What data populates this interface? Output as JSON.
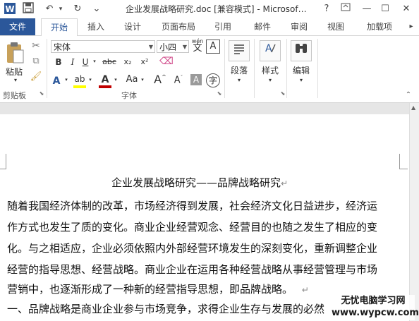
{
  "titlebar": {
    "document_title": "企业发展战略研究.doc [兼容模式] - Microsof…",
    "help": "?"
  },
  "tabs": [
    "文件",
    "开始",
    "插入",
    "设计",
    "页面布局",
    "引用",
    "邮件",
    "审阅",
    "视图",
    "加载项"
  ],
  "clipboard": {
    "paste_label": "粘贴",
    "group_label": "剪贴板"
  },
  "font": {
    "name": "宋体",
    "size": "小四",
    "group_label": "字体",
    "wen_label": "wén",
    "wen_char": "文",
    "a_box": "A",
    "bold": "B",
    "italic": "I",
    "underline": "U",
    "strike": "abc",
    "subscript": "x₂",
    "superscript": "x²",
    "case_label": "Aa"
  },
  "paragraph": {
    "label": "段落"
  },
  "styles": {
    "label": "样式"
  },
  "editing": {
    "label": "编辑"
  },
  "document": {
    "title_line": "企业发展战略研究——品牌战略研究",
    "lines": [
      "随着我国经济体制的改革，市场经济得到发展，社会经济文化日益进步，经济运",
      "作方式也发生了质的变化。商业企业经营观念、经营目的也随之发生了相应的变",
      "化。与之相适应，企业必须依照内外部经营环境发生的深刻变化，重新调整企业",
      "经营的指导思想、经营战略。商业企业在运用各种经营战略从事经营管理与市场",
      "营销中，也逐渐形成了一种新的经营指导思想，即品牌战略。",
      "一、品牌战略是商业企业参与市场竞争，求得企业生存与发展的必然"
    ],
    "para_mark": "↵"
  },
  "watermark": {
    "line1": "无忧电脑学习网",
    "line2": "www.wypcw.com"
  },
  "colors": {
    "accent": "#2b579a",
    "highlight": "#ffff00",
    "font_color": "#c00000"
  }
}
